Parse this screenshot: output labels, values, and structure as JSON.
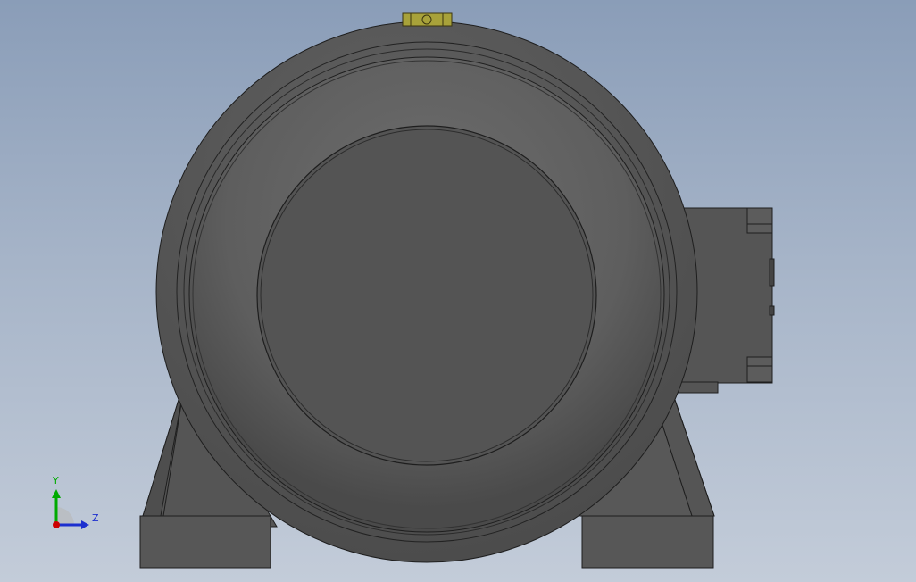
{
  "viewport": {
    "background_top": "#8a9db8",
    "background_bottom": "#c3ccd9"
  },
  "model": {
    "body_color": "#5a5a5a",
    "face_color": "#545454",
    "edge_color": "#1e1e1e",
    "plug_color": "#a8a23a"
  },
  "triad": {
    "y_label": "Y",
    "z_label": "Z",
    "y_color": "#00aa00",
    "z_color": "#1c2fcf",
    "x_color": "#cc0000"
  }
}
